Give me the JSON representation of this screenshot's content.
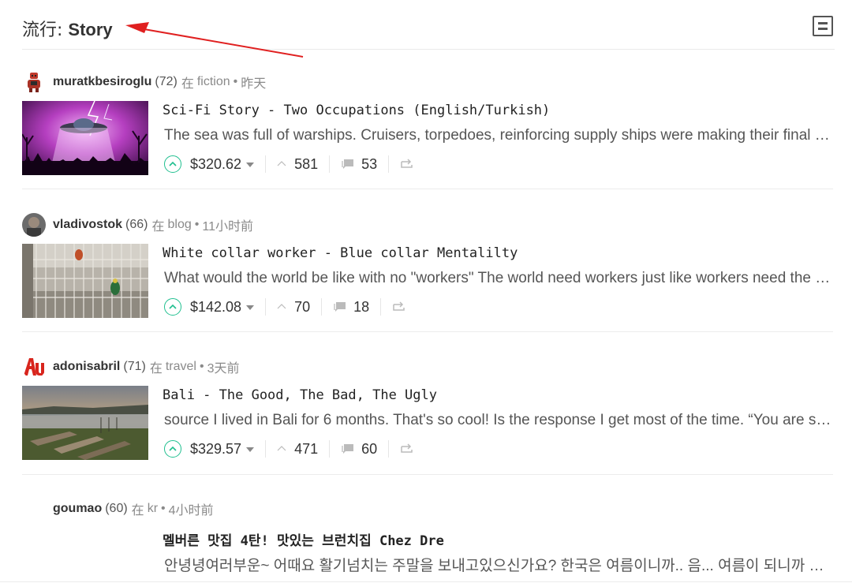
{
  "header": {
    "title_prefix": "流行: ",
    "title_tag": "Story",
    "view_toggle_icon": "list-view-icon"
  },
  "annotation": {
    "arrow_color": "#e02020"
  },
  "posts": [
    {
      "author": "muratkbesiroglu",
      "reputation": "(72)",
      "in": "在",
      "category": "fiction",
      "dot": "•",
      "time": "昨天",
      "title": "Sci-Fi Story - Two Occupations (English/Turkish)",
      "body": "The sea was full of warships. Cruisers, torpedoes, reinforcing supply ships were making their final preparations",
      "payout": "$320.62",
      "votes": "581",
      "comments": "53",
      "avatar_icon": "robot-avatar",
      "thumbnail": "ufo-lightning-thumbnail"
    },
    {
      "author": "vladivostok",
      "reputation": "(66)",
      "in": "在",
      "category": "blog",
      "dot": "•",
      "time": "11小时前",
      "title": "White collar worker - Blue collar Mentalilty",
      "body": "What would the world be like with no \"workers\" The world need workers just like workers need the world",
      "payout": "$142.08",
      "votes": "70",
      "comments": "18",
      "avatar_icon": "photo-avatar",
      "thumbnail": "birdcage-thumbnail"
    },
    {
      "author": "adonisabril",
      "reputation": "(71)",
      "in": "在",
      "category": "travel",
      "dot": "•",
      "time": "3天前",
      "title": "Bali - The Good, The Bad, The Ugly",
      "body": "source I lived in Bali for 6 months. That's so cool! Is the response I get most of the time. “You are so lucky",
      "payout": "$329.57",
      "votes": "471",
      "comments": "60",
      "avatar_icon": "au-logo-avatar",
      "thumbnail": "bali-boats-thumbnail"
    },
    {
      "author": "goumao",
      "reputation": "(60)",
      "in": "在",
      "category": "kr",
      "dot": "•",
      "time": "4小时前",
      "title": "멜버른 맛집 4탄! 맛있는 브런치집 Chez Dre",
      "body": "안녕녕여러부운~ 어때요 활기넘치는 주말을 보내고있으신가요? 한국은 여름이니까.. 음... 여름이 되니까 더 맛있는",
      "payout": "",
      "votes": "",
      "comments": ""
    }
  ],
  "colors": {
    "upvote": "#1fbf8f",
    "muted": "#8a8a8a"
  }
}
